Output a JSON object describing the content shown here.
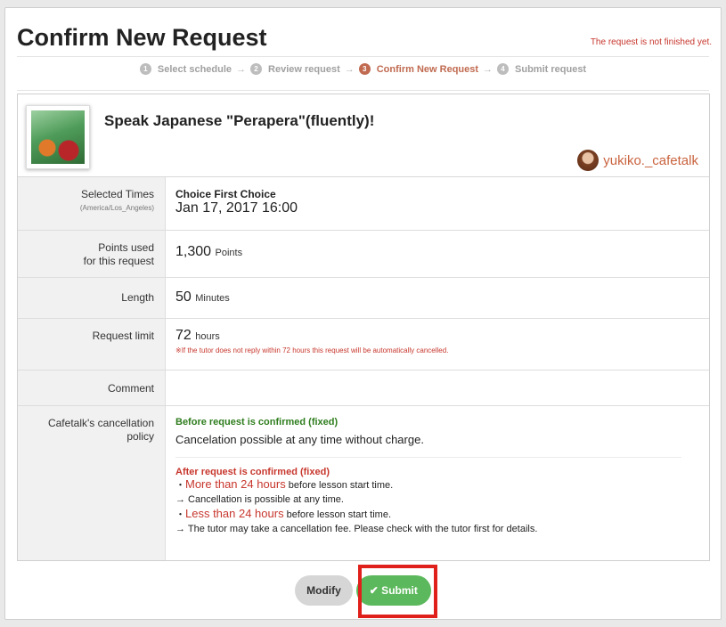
{
  "page": {
    "title": "Confirm New Request",
    "unfinished_note": "The request is not finished yet."
  },
  "steps": [
    {
      "num": "1",
      "label": "Select schedule"
    },
    {
      "num": "2",
      "label": "Review request"
    },
    {
      "num": "3",
      "label": "Confirm New Request"
    },
    {
      "num": "4",
      "label": "Submit request"
    }
  ],
  "step_arrow": "→",
  "lesson": {
    "title": "Speak Japanese \"Perapera\"(fluently)!",
    "tutor": "yukiko._cafetalk",
    "thumbnail_icon": "lesson-thumbnail-image"
  },
  "details": {
    "selected_times": {
      "label": "Selected Times",
      "timezone": "(America/Los_Angeles)",
      "choice": "Choice First Choice",
      "datetime": "Jan 17, 2017 16:00"
    },
    "points": {
      "label_line1": "Points used",
      "label_line2": "for this request",
      "value": "1,300",
      "unit": "Points"
    },
    "length": {
      "label": "Length",
      "value": "50",
      "unit": "Minutes"
    },
    "request_limit": {
      "label": "Request limit",
      "value": "72",
      "unit": "hours",
      "note": "※If the tutor does not reply within 72 hours this request will be automatically cancelled."
    },
    "comment": {
      "label": "Comment",
      "value": ""
    },
    "policy": {
      "label_line1": "Cafetalk's cancellation",
      "label_line2": "policy",
      "before_title": "Before request is confirmed (fixed)",
      "before_text": "Cancelation possible at any time without charge.",
      "after_title": "After request is confirmed (fixed)",
      "line1_bullet": "・",
      "line1_highlight": "More than 24 hours",
      "line1_rest": " before lesson start time.",
      "line2": "→ Cancellation is possible at any time.",
      "line3_bullet": "・",
      "line3_highlight": "Less than 24 hours",
      "line3_rest": " before lesson start time.",
      "line4": "→ The tutor may take a cancellation fee. Please check with the tutor first for details."
    }
  },
  "buttons": {
    "modify": "Modify",
    "submit": "✔ Submit"
  },
  "colors": {
    "accent": "#c06a50",
    "submit_green": "#5cb85c",
    "warning_red": "#c7372d",
    "highlight_red": "#e0201a"
  }
}
